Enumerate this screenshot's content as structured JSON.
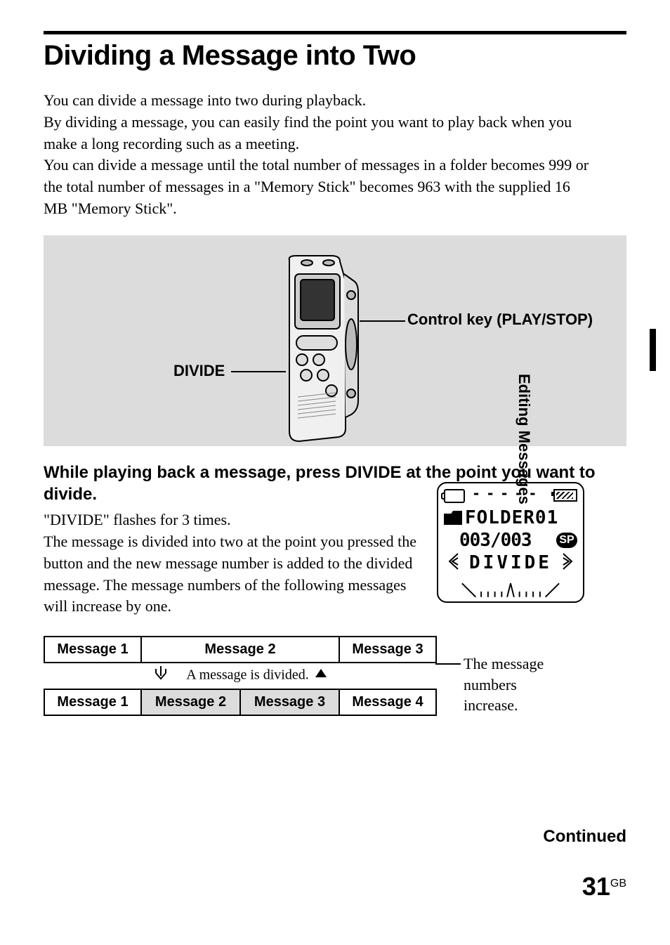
{
  "page": {
    "title": "Dividing a Message into Two",
    "intro": "You can divide a message into two during playback.\nBy dividing a message, you can easily find the point you want to play back when you make a long recording such as a meeting.\nYou can divide a message until the total number of messages in a folder becomes 999 or the total number of messages in a \"Memory Stick\" becomes 963 with the supplied 16 MB \"Memory Stick\".",
    "labels": {
      "divide": "DIVIDE",
      "control_key": "Control key (PLAY/STOP)"
    },
    "step_heading": "While playing back a message, press DIVIDE at the point you want to divide.",
    "step_body": "\"DIVIDE\" flashes for 3 times.\nThe message is divided into two at the point you pressed the button and the new message number is added to the divided message.  The message numbers of the following messages will increase by one.",
    "lcd": {
      "dashes": "- - - - -",
      "folder": "FOLDER01",
      "count": "003/003",
      "sp": "SP",
      "flash_text": "DIVIDE"
    },
    "msg_table": {
      "before": [
        "Message 1",
        "Message 2",
        "Message 3"
      ],
      "caption": "A message is divided.",
      "after": [
        "Message 1",
        "Message 2",
        "Message 3",
        "Message 4"
      ],
      "side_note": "The message numbers increase."
    },
    "side_tab": "Editing Messages",
    "continued": "Continued",
    "page_number": "31",
    "page_number_suffix": "GB"
  }
}
